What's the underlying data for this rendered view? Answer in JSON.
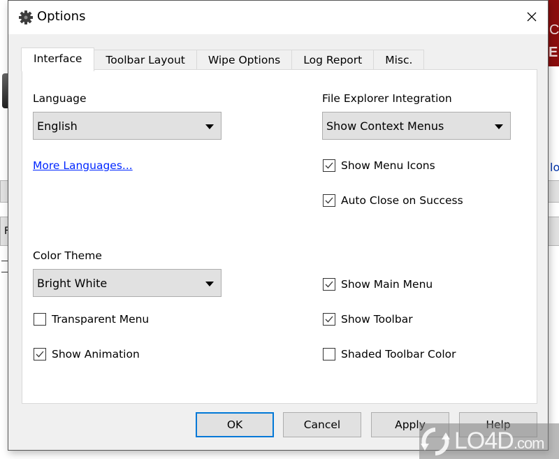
{
  "dialog": {
    "title": "Options",
    "close_glyph": "×"
  },
  "tabs": [
    {
      "label": "Interface",
      "active": true
    },
    {
      "label": "Toolbar Layout",
      "active": false
    },
    {
      "label": "Wipe Options",
      "active": false
    },
    {
      "label": "Log Report",
      "active": false
    },
    {
      "label": "Misc.",
      "active": false
    }
  ],
  "interface": {
    "language": {
      "label": "Language",
      "selected": "English",
      "more_link": "More Languages..."
    },
    "file_explorer": {
      "label": "File Explorer Integration",
      "selected": "Show Context Menus"
    },
    "color_theme": {
      "label": "Color Theme",
      "selected": "Bright White"
    },
    "checkboxes_left": [
      {
        "label": "Transparent Menu",
        "checked": false
      },
      {
        "label": "Show Animation",
        "checked": true
      }
    ],
    "checkboxes_right_top": [
      {
        "label": "Show Menu Icons",
        "checked": true
      },
      {
        "label": "Auto Close on Success",
        "checked": true
      }
    ],
    "checkboxes_right_bottom": [
      {
        "label": "Show Main Menu",
        "checked": true
      },
      {
        "label": "Show Toolbar",
        "checked": true
      },
      {
        "label": "Shaded Toolbar Color",
        "checked": false
      }
    ]
  },
  "buttons": {
    "ok": "OK",
    "cancel": "Cancel",
    "apply": "Apply",
    "help": "Help"
  },
  "watermark": {
    "brand": "LO4D",
    "suffix": ".com"
  },
  "background": {
    "partial_link_text": "lo",
    "partial_button_text": "F"
  }
}
